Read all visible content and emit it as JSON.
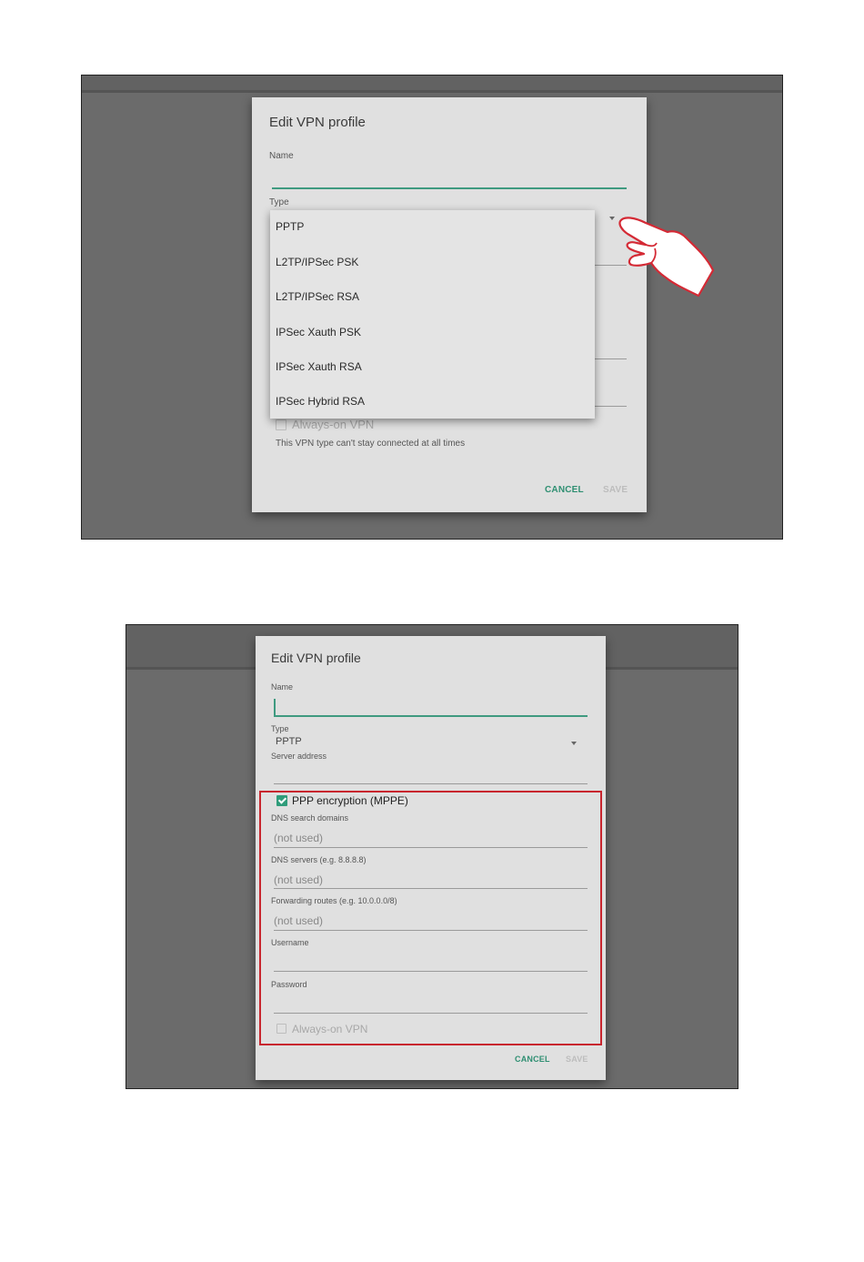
{
  "dialog": {
    "title": "Edit VPN profile",
    "name_label": "Name",
    "type_label": "Type",
    "type_value": "PPTP",
    "server_label": "Server address",
    "cancel_label": "CANCEL",
    "save_label": "SAVE",
    "always_on_label": "Always-on VPN",
    "always_on_note": "This VPN type can't stay connected at all times",
    "ppp_label": "PPP encryption (MPPE)",
    "dns_search_label": "DNS search domains",
    "dns_search_placeholder": "(not used)",
    "dns_servers_label": "DNS servers (e.g. 8.8.8.8)",
    "dns_servers_placeholder": "(not used)",
    "routes_label": "Forwarding routes (e.g. 10.0.0.0/8)",
    "routes_placeholder": "(not used)",
    "username_label": "Username",
    "password_label": "Password"
  },
  "type_menu": {
    "options": [
      "PPTP",
      "L2TP/IPSec PSK",
      "L2TP/IPSec RSA",
      "IPSec Xauth PSK",
      "IPSec Xauth RSA",
      "IPSec Hybrid RSA"
    ]
  },
  "colors": {
    "accent": "#2f8f72",
    "highlight": "#c8252e",
    "hand": "#d42a35"
  }
}
